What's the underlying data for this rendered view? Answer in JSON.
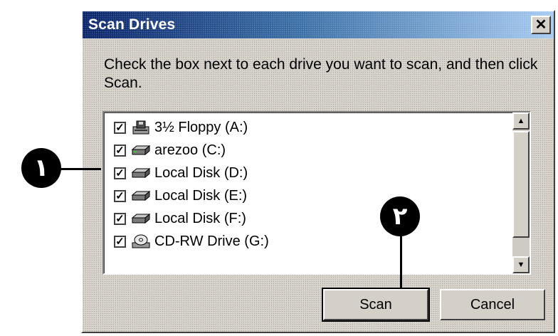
{
  "dialog": {
    "title": "Scan Drives",
    "close_glyph": "✕",
    "instructions": "Check the box next to each drive you want to scan, and then click Scan."
  },
  "drives": [
    {
      "label": "3½ Floppy (A:)",
      "checked": true,
      "icon": "floppy-drive-icon"
    },
    {
      "label": "arezoo (C:)",
      "checked": true,
      "icon": "hard-disk-icon"
    },
    {
      "label": "Local Disk (D:)",
      "checked": true,
      "icon": "hard-disk-icon"
    },
    {
      "label": "Local Disk (E:)",
      "checked": true,
      "icon": "hard-disk-icon"
    },
    {
      "label": "Local Disk (F:)",
      "checked": true,
      "icon": "hard-disk-icon"
    },
    {
      "label": "CD-RW Drive (G:)",
      "checked": true,
      "icon": "cd-drive-icon"
    }
  ],
  "buttons": {
    "scan": "Scan",
    "cancel": "Cancel"
  },
  "callouts": {
    "one": "١",
    "two": "٢"
  },
  "check_glyph": "✓",
  "scroll_up_glyph": "▲",
  "scroll_down_glyph": "▼"
}
